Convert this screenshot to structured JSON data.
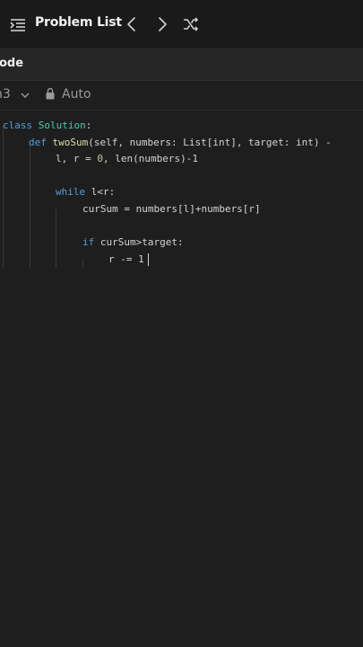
{
  "topbar": {
    "title": "Problem List",
    "icons": [
      "list-icon",
      "chevron-left-icon",
      "chevron-right-icon",
      "shuffle-icon"
    ]
  },
  "panel": {
    "label": "ode"
  },
  "toolbar": {
    "language": "n3",
    "mode": "Auto"
  },
  "code": {
    "lines": [
      {
        "tokens": [
          {
            "t": "class",
            "c": "kw"
          },
          {
            "t": " ",
            "c": "plain"
          },
          {
            "t": "Solution",
            "c": "cls"
          },
          {
            "t": ":",
            "c": "plain"
          }
        ]
      },
      {
        "tokens": [
          {
            "t": "def",
            "c": "kw"
          },
          {
            "t": " ",
            "c": "plain"
          },
          {
            "t": "twoSum",
            "c": "fn"
          },
          {
            "t": "(self, numbers: List[int], target: int) -",
            "c": "plain"
          }
        ]
      },
      {
        "tokens": [
          {
            "t": "l, r = ",
            "c": "plain"
          },
          {
            "t": "0",
            "c": "num"
          },
          {
            "t": ", len(numbers)-1",
            "c": "plain"
          }
        ]
      },
      {
        "tokens": []
      },
      {
        "tokens": [
          {
            "t": "while",
            "c": "kw"
          },
          {
            "t": " l<r:",
            "c": "plain"
          }
        ]
      },
      {
        "tokens": [
          {
            "t": "curSum = numbers[l]+numbers[r]",
            "c": "plain"
          }
        ]
      },
      {
        "tokens": []
      },
      {
        "tokens": [
          {
            "t": "if",
            "c": "kw"
          },
          {
            "t": " curSum>target:",
            "c": "plain"
          }
        ]
      },
      {
        "tokens": [
          {
            "t": "r -= 1",
            "c": "plain"
          }
        ]
      }
    ]
  }
}
